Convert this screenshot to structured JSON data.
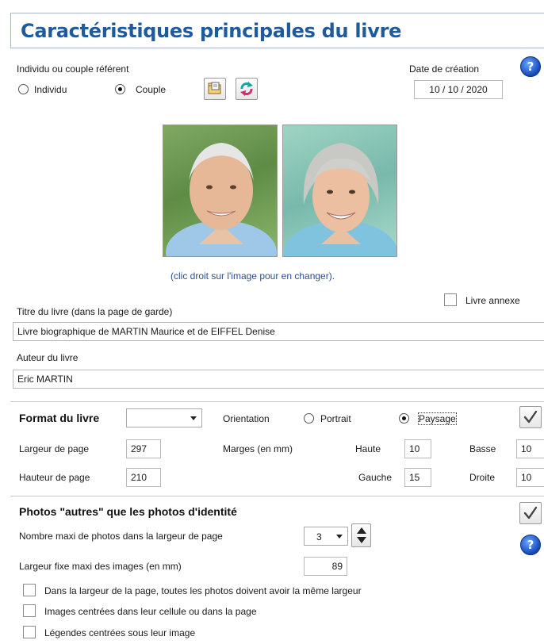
{
  "header": {
    "title": "Caractéristiques principales du livre"
  },
  "referent": {
    "label": "Individu ou couple référent",
    "option_individu": "Individu",
    "option_couple": "Couple",
    "selected": "Couple"
  },
  "creation": {
    "label": "Date de création",
    "value": "10 / 10 / 2020"
  },
  "photos": {
    "caption": "(clic droit sur l'image pour en changer)."
  },
  "annex": {
    "label": "Livre annexe"
  },
  "book_title": {
    "label": "Titre du livre (dans la page de garde)",
    "value": "Livre biographique de MARTIN Maurice et de EIFFEL Denise"
  },
  "author": {
    "label": "Auteur du livre",
    "value": "Eric MARTIN"
  },
  "format": {
    "section_label": "Format du livre",
    "format_value": "",
    "orientation_label": "Orientation",
    "portrait": "Portrait",
    "paysage": "Paysage",
    "orientation_selected": "Paysage",
    "page_width_label": "Largeur de page",
    "page_width": "297",
    "page_height_label": "Hauteur de page",
    "page_height": "210",
    "margins_label": "Marges  (en mm)",
    "top_label": "Haute",
    "top": "10",
    "bottom_label": "Basse",
    "bottom": "10",
    "left_label": "Gauche",
    "left": "15",
    "right_label": "Droite",
    "right": "10"
  },
  "other_photos": {
    "section_label": "Photos \"autres\" que les photos d'identité",
    "max_per_width_label": "Nombre maxi de photos dans la largeur de page",
    "max_per_width": "3",
    "fixed_width_label": "Largeur fixe maxi des images (en mm)",
    "fixed_width": "89",
    "opt_same_width": "Dans la largeur de la page, toutes les photos doivent avoir la même largeur",
    "opt_centered_images": "Images centrées dans leur cellule ou dans la page",
    "opt_centered_captions": "Légendes centrées sous leur image"
  },
  "colors": {
    "title": "#1f5a9c",
    "caption": "#2a4f8c",
    "help": "#1448b8"
  }
}
